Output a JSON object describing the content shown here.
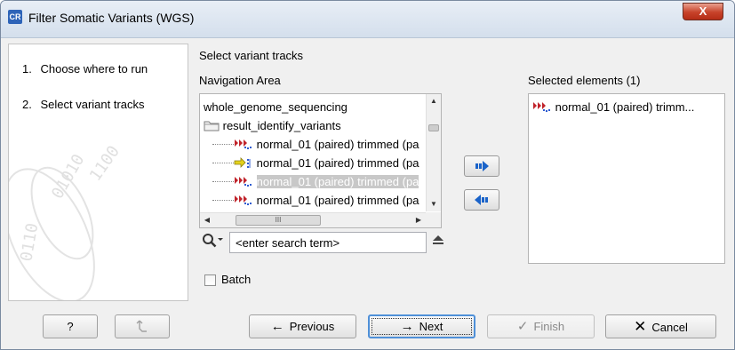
{
  "window": {
    "title": "Filter Somatic Variants (WGS)",
    "app_icon_text": "CR",
    "close_glyph": "X"
  },
  "steps": [
    {
      "number": "1.",
      "label": "Choose where to run"
    },
    {
      "number": "2.",
      "label": "Select variant tracks"
    }
  ],
  "main": {
    "section_title": "Select variant tracks",
    "nav_area_label": "Navigation Area",
    "selected_label": "Selected elements (1)"
  },
  "tree": {
    "items": [
      {
        "label": "whole_genome_sequencing",
        "icon": "none",
        "selected": false
      },
      {
        "label": "result_identify_variants",
        "icon": "folder-icon",
        "selected": false
      },
      {
        "label": "normal_01 (paired) trimmed (pa",
        "icon": "variant-track-icon",
        "selected": false
      },
      {
        "label": "normal_01 (paired) trimmed (pa",
        "icon": "annotation-track-icon",
        "selected": false
      },
      {
        "label": "normal_01 (paired) trimmed (pa",
        "icon": "variant-track-icon",
        "selected": true
      },
      {
        "label": "normal_01 (paired) trimmed (pa",
        "icon": "variant-track-icon",
        "selected": false
      }
    ],
    "hscroll_thumb_glyph": "III"
  },
  "selected_elements": [
    {
      "label": "normal_01 (paired) trimm...",
      "icon": "variant-track-icon"
    }
  ],
  "search": {
    "placeholder": "<enter search term>",
    "value": ""
  },
  "batch": {
    "label": "Batch",
    "checked": false
  },
  "footer": {
    "help_label": "?",
    "previous_label": "Previous",
    "next_label": "Next",
    "finish_label": "Finish",
    "cancel_label": "Cancel"
  },
  "colors": {
    "move_arrow": "#1a63c9",
    "track_red": "#c0232a",
    "track_blue": "#2d5bd1",
    "cancel_x": "#1a1a1a"
  }
}
